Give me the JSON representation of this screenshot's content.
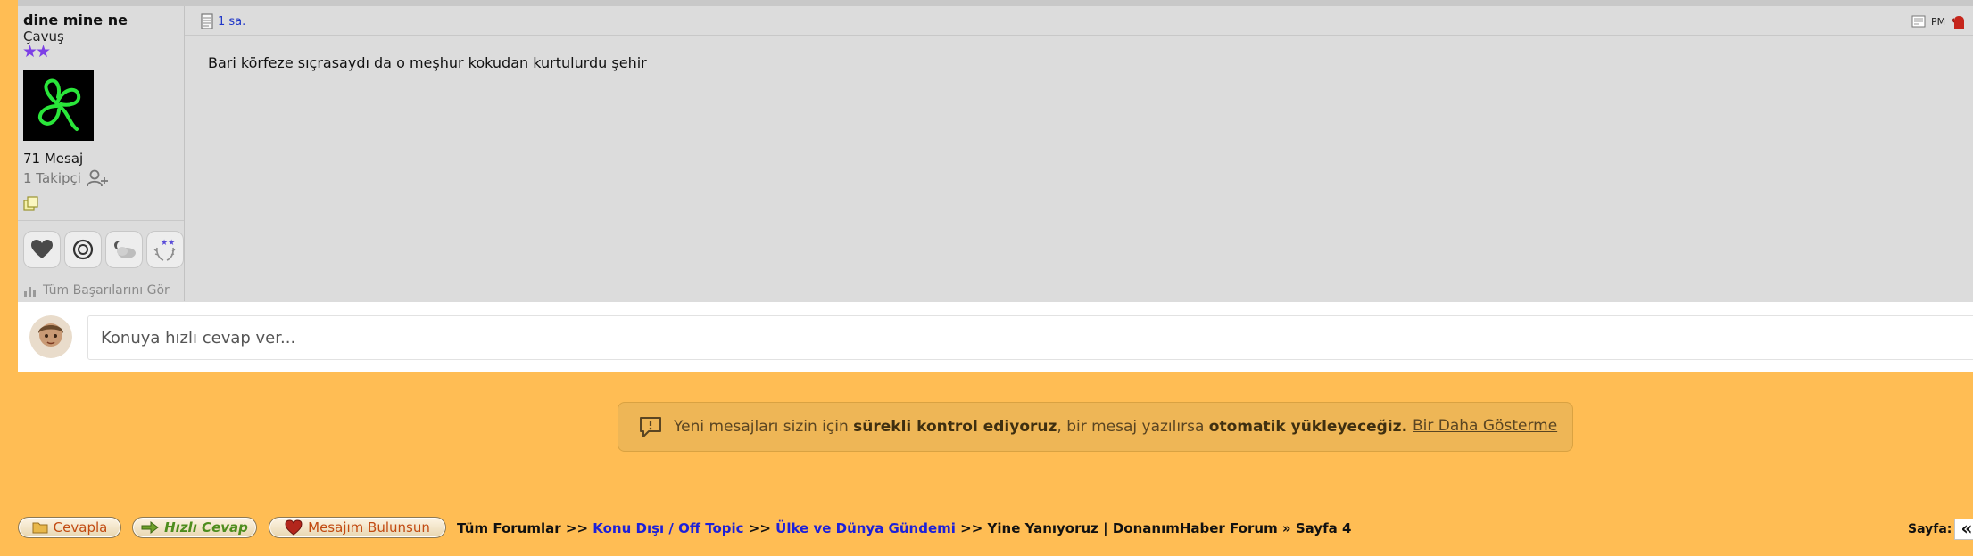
{
  "post": {
    "author": "dine mine ne",
    "rank": "Çavuş",
    "stars": "★★",
    "message_count": "71 Mesaj",
    "followers": "1 Takipçi",
    "all_achievements": "Tüm Başarılarını Gör",
    "time": "1 sa.",
    "pm_label": "PM",
    "body": "Bari körfeze sıçrasaydı da o meşhur kokudan kurtulurdu şehir"
  },
  "quick_reply": {
    "placeholder": "Konuya hızlı cevap ver..."
  },
  "notice": {
    "text_a": "Yeni mesajları sizin için ",
    "bold_a": "sürekli kontrol ediyoruz",
    "text_b": ", bir mesaj yazılırsa ",
    "bold_b": "otomatik yükleyeceğiz.",
    "dismiss": "Bir Daha Gösterme"
  },
  "toolbar": {
    "reply_label": "Cevapla",
    "quick_reply_label": "Hızlı Cevap",
    "find_post_label": "Mesajım Bulunsun"
  },
  "breadcrumb": {
    "root": "Tüm Forumlar",
    "sep": ">>",
    "cat1": "Konu Dışı / Off Topic",
    "cat2": "Ülke ve Dünya Gündemi",
    "tail": "Yine Yanıyoruz | DonanımHaber Forum » Sayfa 4"
  },
  "pagination": {
    "label": "Sayfa:",
    "first_icon": "«"
  },
  "colors": {
    "page_bg": "#FFBD54",
    "post_bg": "#DCDCDC",
    "link": "#1C20D9",
    "star": "#7D3FE6"
  }
}
